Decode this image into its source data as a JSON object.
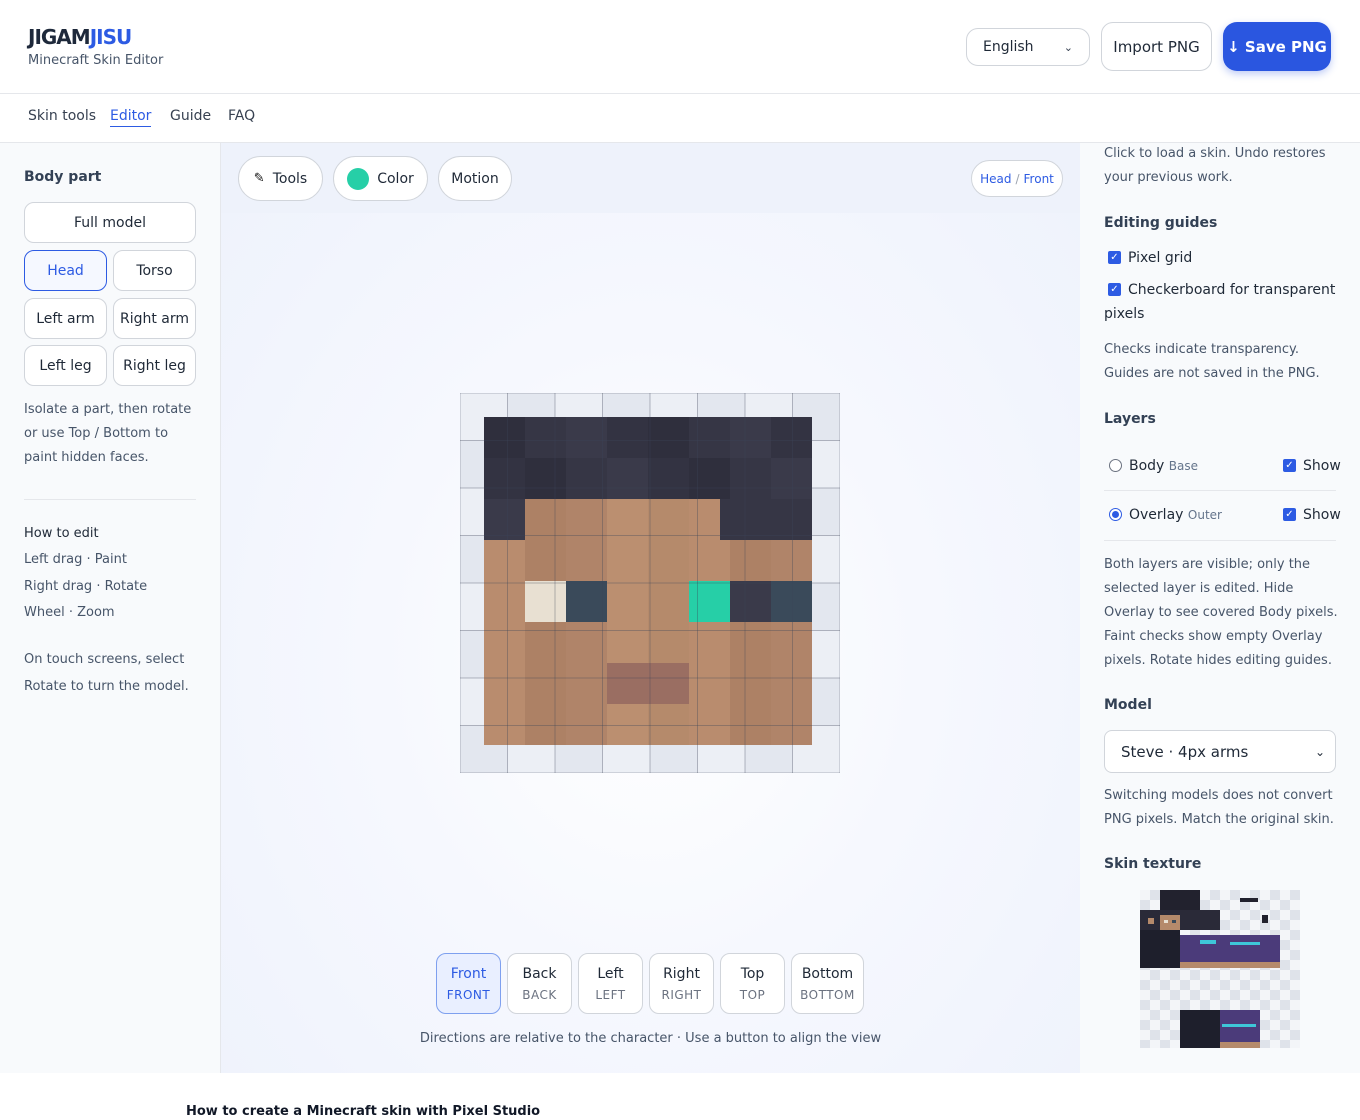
{
  "brand": {
    "name_a": "JIGAM",
    "name_b": "JISU",
    "subtitle": "Minecraft Skin Editor"
  },
  "header": {
    "language": "English",
    "import_label": "Import PNG",
    "save_label": "↓ Save PNG"
  },
  "nav": [
    "Skin tools",
    "Editor",
    "Guide",
    "FAQ"
  ],
  "left": {
    "body_part_title": "Body part",
    "parts": {
      "full": "Full model",
      "head": "Head",
      "torso": "Torso",
      "left_arm": "Left arm",
      "right_arm": "Right arm",
      "left_leg": "Left leg",
      "right_leg": "Right leg"
    },
    "isolate_lines": [
      "Isolate a part, then rotate",
      "or use Top / Bottom to",
      "paint hidden faces."
    ],
    "how_title": "How to edit",
    "how_lines": [
      "Left drag · Paint",
      "Right drag · Rotate",
      "Wheel · Zoom"
    ],
    "touch_lines": [
      "On touch screens, select",
      "Rotate to turn the model."
    ]
  },
  "toolbar": {
    "tools": "Tools",
    "color": "Color",
    "motion": "Motion",
    "face_part": "Head",
    "face_sep": "/",
    "face_side": "Front"
  },
  "active_color": "#26cfa7",
  "views": [
    {
      "label": "Front",
      "sub": "FRONT"
    },
    {
      "label": "Back",
      "sub": "BACK"
    },
    {
      "label": "Left",
      "sub": "LEFT"
    },
    {
      "label": "Right",
      "sub": "RIGHT"
    },
    {
      "label": "Top",
      "sub": "TOP"
    },
    {
      "label": "Bottom",
      "sub": "BOTTOM"
    }
  ],
  "canvas_note": "Directions are relative to the character · Use a button to align the view",
  "right": {
    "intro_lines": [
      "Click to load a skin. Undo restores",
      "your previous work."
    ],
    "guides_title": "Editing guides",
    "pixel_grid": "Pixel grid",
    "checker_a": "Checkerboard for transparent",
    "checker_b": "pixels",
    "guides_note_lines": [
      "Checks indicate transparency.",
      "Guides are not saved in the PNG."
    ],
    "layers_title": "Layers",
    "layer_body": "Body",
    "layer_body_sub": "Base",
    "layer_overlay": "Overlay",
    "layer_overlay_sub": "Outer",
    "show": "Show",
    "layers_note_lines": [
      "Both layers are visible; only the",
      "selected layer is edited. Hide",
      "Overlay to see covered Body pixels.",
      "Faint checks show empty Overlay",
      "pixels. Rotate hides editing guides."
    ],
    "model_title": "Model",
    "model_value": "Steve · 4px arms",
    "model_note_lines": [
      "Switching models does not convert",
      "PNG pixels. Match the original skin."
    ],
    "texture_title": "Skin texture"
  },
  "footer_title": "How to create a Minecraft skin with Pixel Studio",
  "colors": {
    "hair": "#363645",
    "skin": "#b58a6b",
    "eye_white": "#e8e0d2",
    "eye_dark": "#3a4a5a",
    "mouth": "#9a6e62"
  }
}
